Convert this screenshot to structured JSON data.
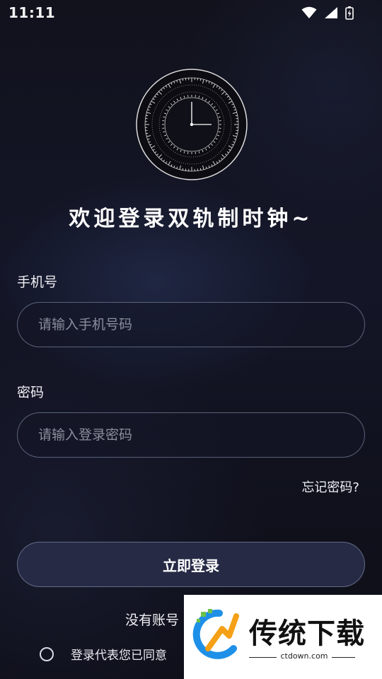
{
  "status_bar": {
    "time": "11:11"
  },
  "welcome": {
    "title": "欢迎登录双轨制时钟~"
  },
  "phone": {
    "label": "手机号",
    "placeholder": "请输入手机号码",
    "value": ""
  },
  "password": {
    "label": "密码",
    "placeholder": "请输入登录密码",
    "value": ""
  },
  "forgot": {
    "label": "忘记密码?"
  },
  "login": {
    "label": "立即登录"
  },
  "register": {
    "prompt": "没有账号"
  },
  "agreement": {
    "text": "登录代表您已同意",
    "checked": false
  },
  "watermark": {
    "title": "传统下载",
    "domain": "ctdown.com"
  },
  "colors": {
    "accent_button": "#262a45",
    "background": "#12131f"
  }
}
